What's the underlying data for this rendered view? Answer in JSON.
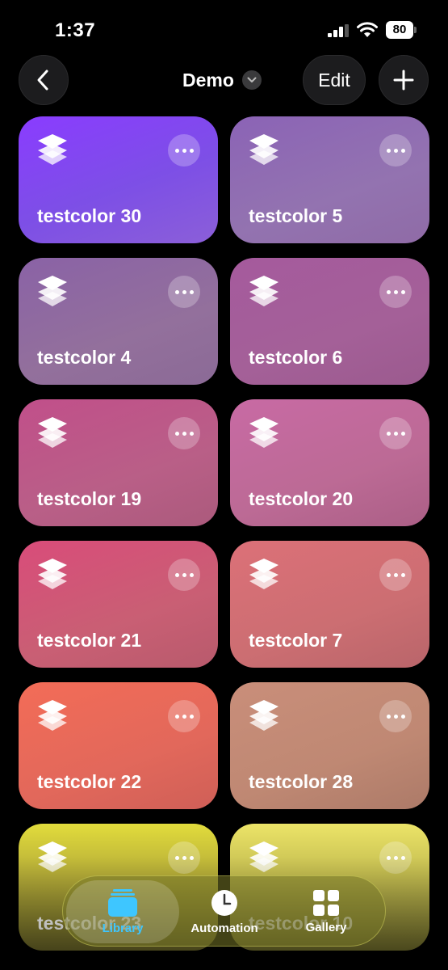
{
  "status": {
    "time": "1:37",
    "battery": "80"
  },
  "nav": {
    "title": "Demo",
    "edit_label": "Edit"
  },
  "tiles": [
    {
      "label": "testcolor 30",
      "bg": "linear-gradient(160deg, #8a3cff 0%, #7d4fe6 55%, #8b5fd8 100%)"
    },
    {
      "label": "testcolor 5",
      "bg": "linear-gradient(160deg, #8b63b6 0%, #9373b0 60%, #8f6ba6 100%)"
    },
    {
      "label": "testcolor 4",
      "bg": "linear-gradient(160deg, #8a62a6 0%, #93709c 60%, #8b6a96 100%)"
    },
    {
      "label": "testcolor 6",
      "bg": "linear-gradient(160deg, #a55a9d 0%, #a46098 60%, #9b5a8e 100%)"
    },
    {
      "label": "testcolor 19",
      "bg": "linear-gradient(160deg, #c14f8a 0%, #b95f87 60%, #ab5a7c 100%)"
    },
    {
      "label": "testcolor 20",
      "bg": "linear-gradient(160deg, #c86aa4 0%, #bc6a95 60%, #ab5f86 100%)"
    },
    {
      "label": "testcolor 21",
      "bg": "linear-gradient(160deg, #d94c7a 0%, #c95f74 60%, #b85a6c 100%)"
    },
    {
      "label": "testcolor 7",
      "bg": "linear-gradient(160deg, #dc7078 0%, #cc6e72 60%, #b9656a 100%)"
    },
    {
      "label": "testcolor 22",
      "bg": "linear-gradient(160deg, #f36c57 0%, #e2685b 60%, #cf5f57 100%)"
    },
    {
      "label": "testcolor 28",
      "bg": "linear-gradient(160deg, #c98e7a 0%, #bf8873 60%, #ac7a68 100%)"
    },
    {
      "label": "testcolor 23",
      "bg": "linear-gradient(180deg, #e2dc3c 0%, #b7ae38 40%, #6f6a2a 100%)"
    },
    {
      "label": "testcolor 10",
      "bg": "linear-gradient(180deg, #ece468 0%, #c4bd50 40%, #76722e 100%)"
    }
  ],
  "tabs": [
    {
      "label": "Library",
      "color": "#3ec6ff",
      "selected": true
    },
    {
      "label": "Automation",
      "color": "#ffffff",
      "selected": false
    },
    {
      "label": "Gallery",
      "color": "#ffffff",
      "selected": false
    }
  ]
}
